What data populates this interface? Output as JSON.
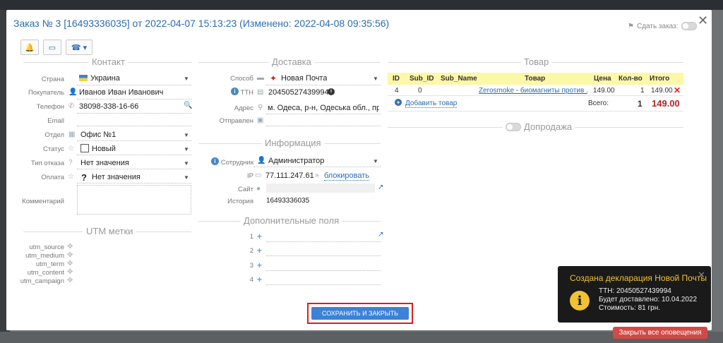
{
  "modal": {
    "title": "Заказ № 3 [16493336035] от 2022-04-07 15:13:23 (Изменено: 2022-04-08 09:35:56)",
    "share_label": "Сдать заказ:",
    "close_icon": "close-icon"
  },
  "toolbar": {
    "buttons": [
      {
        "icon": "bell-icon",
        "glyph": "🔔"
      },
      {
        "icon": "window-icon",
        "glyph": "▭"
      },
      {
        "icon": "phone-icon",
        "glyph": "☎ ▾"
      }
    ]
  },
  "contact": {
    "title": "Контакт",
    "country_label": "Страна",
    "country_value": "Украина",
    "buyer_label": "Покупатель",
    "buyer_value": "Иванов Иван Иванович",
    "phone_label": "Телефон",
    "phone_value": "38098-338-16-66",
    "email_label": "Email",
    "email_value": "",
    "dept_label": "Отдел",
    "dept_value": "Офис №1",
    "status_label": "Статус",
    "status_value": "Новый",
    "reject_label": "Тип отказа",
    "reject_value": "Нет значения",
    "payment_label": "Оплата",
    "payment_value": "Нет значения",
    "comment_label": "Комментарий"
  },
  "utm": {
    "title": "UTM метки",
    "labels": [
      "utm_source",
      "utm_medium",
      "utm_term",
      "utm_content",
      "utm_campaign"
    ]
  },
  "delivery": {
    "title": "Доставка",
    "method_label": "Способ",
    "method_value": "Новая Почта",
    "ttn_label": "ТТН",
    "ttn_value": "20450527439994",
    "address_label": "Адрес",
    "address_value": "м. Одеса, р-н, Одеська обл., про",
    "sent_label": "Отправлен",
    "sent_value": ""
  },
  "info": {
    "title": "Информация",
    "employee_label": "Сотрудник",
    "employee_value": "Администратор",
    "ip_label": "IP",
    "ip_value": "77.111.247.61",
    "block_link": "блокировать",
    "site_label": "Сайт",
    "site_value": "",
    "history_label": "История",
    "history_value": "16493336035"
  },
  "extra": {
    "title": "Дополнительные поля",
    "rows": [
      "1",
      "2",
      "3",
      "4"
    ]
  },
  "goods": {
    "title": "Товар",
    "columns": [
      "ID",
      "Sub_ID",
      "Sub_Name",
      "Товар",
      "Цена",
      "Кол-во",
      "Итого"
    ],
    "rows": [
      {
        "id": "4",
        "sub_id": "0",
        "sub_name": "",
        "product": "Zerosmoke - биомагниты против ...",
        "price": "149.00",
        "qty": "1",
        "total": "149.00"
      }
    ],
    "add_label": "Добавить товар",
    "total_label": "Всего:",
    "total_qty": "1",
    "total_sum": "149.00"
  },
  "upsell": {
    "title": "Допродажа"
  },
  "actions": {
    "save_label": "СОХРАНИТЬ И ЗАКРЫТЬ"
  },
  "toast": {
    "title": "Создана декларация Новой Почты",
    "lines": [
      "ТТН: 20450527439994",
      "Будет доставлено: 10.04.2022",
      "Стоимость: 81 грн."
    ],
    "icon": "info-icon"
  },
  "close_all_label": "Закрыть все оповещения",
  "colors": {
    "accent": "#3b82d8",
    "title_blue": "#2b6cb0",
    "toast_bg": "#1a1a1a",
    "toast_accent": "#f1c232",
    "danger": "#d24a46",
    "table_head": "#fdf7a8",
    "total_red": "#b22222"
  }
}
